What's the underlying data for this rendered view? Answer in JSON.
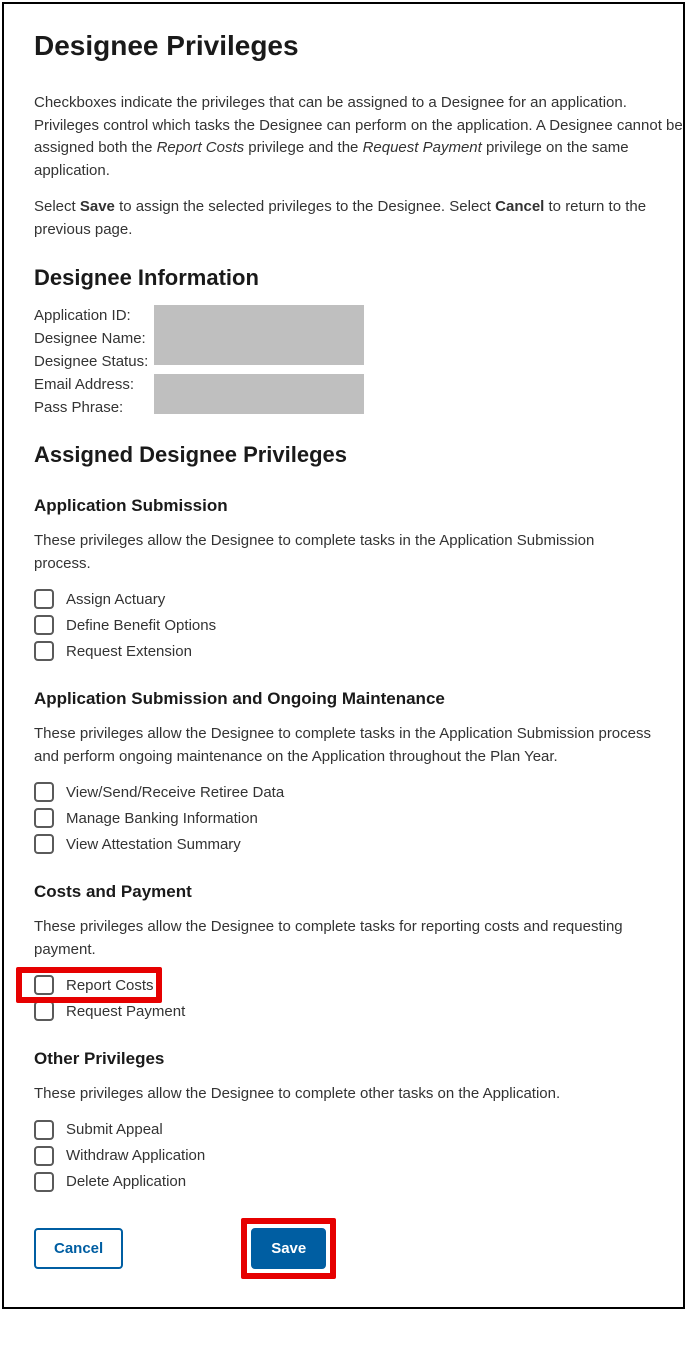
{
  "page": {
    "title": "Designee Privileges",
    "intro_p1_a": "Checkboxes indicate the privileges that can be assigned to a Designee for an application. Privileges control which tasks the Designee can perform on the application. A Designee cannot be assigned both the ",
    "intro_p1_rc": "Report Costs",
    "intro_p1_b": " privilege and the ",
    "intro_p1_rp": "Request Payment",
    "intro_p1_c": " privilege on the same application.",
    "intro_p2_a": "Select ",
    "intro_p2_save": "Save",
    "intro_p2_b": " to assign the selected privileges to the Designee. Select ",
    "intro_p2_cancel": "Cancel",
    "intro_p2_c": " to return to the previous page."
  },
  "designee_info": {
    "heading": "Designee Information",
    "labels": {
      "app_id": "Application ID:",
      "name": "Designee Name:",
      "status": "Designee Status:",
      "email": "Email Address:",
      "pass": "Pass Phrase:"
    }
  },
  "assigned": {
    "heading": "Assigned Designee Privileges"
  },
  "sections": {
    "app_sub": {
      "title": "Application Submission",
      "desc": "These privileges allow the Designee to complete tasks in the Application Submission process.",
      "items": {
        "assign_actuary": "Assign Actuary",
        "define_benefit": "Define Benefit Options",
        "request_ext": "Request Extension"
      }
    },
    "app_maint": {
      "title": "Application Submission and Ongoing Maintenance",
      "desc": "These privileges allow the Designee to complete tasks in the Application Submission process and perform ongoing maintenance on the Application throughout the Plan Year.",
      "items": {
        "retiree": "View/Send/Receive Retiree Data",
        "banking": "Manage Banking Information",
        "attest": "View Attestation Summary"
      }
    },
    "costs": {
      "title": "Costs and Payment",
      "desc": "These privileges allow the Designee to complete tasks for reporting costs and requesting payment.",
      "items": {
        "report": "Report Costs",
        "request_pay": "Request Payment"
      }
    },
    "other": {
      "title": "Other Privileges",
      "desc": "These privileges allow the Designee to complete other tasks on the Application.",
      "items": {
        "appeal": "Submit Appeal",
        "withdraw": "Withdraw Application",
        "delete": "Delete Application"
      }
    }
  },
  "buttons": {
    "cancel": "Cancel",
    "save": "Save"
  }
}
